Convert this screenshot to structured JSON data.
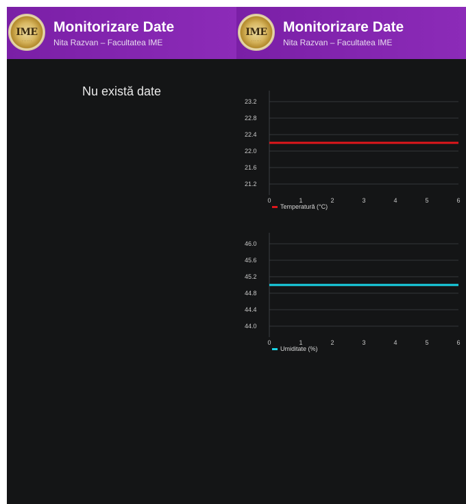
{
  "header": {
    "title": "Monitorizare Date",
    "subtitle": "Nita Razvan – Facultatea IME",
    "logo_text": "IME"
  },
  "empty_state": {
    "message": "Nu există date"
  },
  "chart_data": [
    {
      "type": "line",
      "ylim": [
        21.0,
        23.4
      ],
      "xlim": [
        0,
        6
      ],
      "yticks": [
        "23.2",
        "22.8",
        "22.4",
        "22.0",
        "21.6",
        "21.2"
      ],
      "xticks": [
        "0",
        "1",
        "2",
        "3",
        "4",
        "5",
        "6"
      ],
      "series": [
        {
          "name": "Temperatură (°C)",
          "color": "#e0161b",
          "x": [
            0,
            1,
            2,
            3,
            4,
            5,
            6
          ],
          "values": [
            22.2,
            22.2,
            22.2,
            22.2,
            22.2,
            22.2,
            22.2
          ]
        }
      ],
      "legend": "bottom-left",
      "grid": true
    },
    {
      "type": "line",
      "ylim": [
        43.8,
        46.2
      ],
      "xlim": [
        0,
        6
      ],
      "yticks": [
        "46.0",
        "45.6",
        "45.2",
        "44.8",
        "44.4",
        "44.0"
      ],
      "xticks": [
        "0",
        "1",
        "2",
        "3",
        "4",
        "5",
        "6"
      ],
      "series": [
        {
          "name": "Umiditate (%)",
          "color": "#19d3e6",
          "x": [
            0,
            1,
            2,
            3,
            4,
            5,
            6
          ],
          "values": [
            45.0,
            45.0,
            45.0,
            45.0,
            45.0,
            45.0,
            45.0
          ]
        }
      ],
      "legend": "bottom-left",
      "grid": true
    }
  ]
}
